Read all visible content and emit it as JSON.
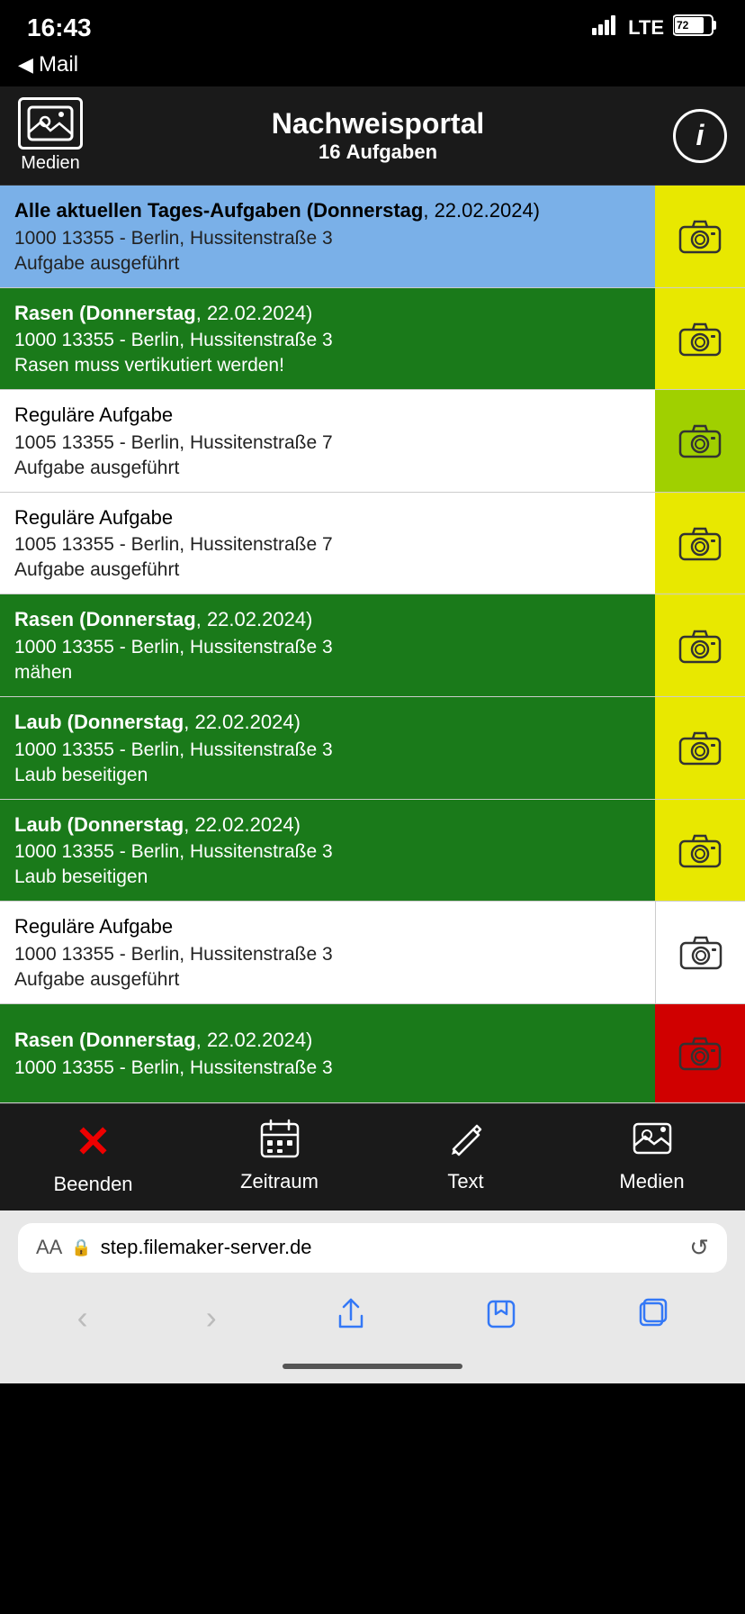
{
  "statusBar": {
    "time": "16:43",
    "signal": "▲▲▲",
    "network": "LTE",
    "battery": "72"
  },
  "mailBack": "Mail",
  "header": {
    "mediaLabel": "Medien",
    "title": "Nachweisportal",
    "subtitleCount": "16",
    "subtitleText": "Aufgaben",
    "infoLabel": "i"
  },
  "tasks": [
    {
      "id": 1,
      "bgClass": "bg-blue",
      "camClass": "cam-yellow",
      "titleBold": "Alle aktuellen Tages-Aufgaben (Donnerstag",
      "titleRest": ", 22.02.2024)",
      "address": "1000    13355 - Berlin, Hussitenstraße 3",
      "desc": "Aufgabe ausgeführt"
    },
    {
      "id": 2,
      "bgClass": "bg-green",
      "camClass": "cam-yellow",
      "titleBold": "Rasen (Donnerstag",
      "titleRest": ", 22.02.2024)",
      "address": "1000    13355 - Berlin, Hussitenstraße 3",
      "desc": "Rasen muss vertikutiert werden!"
    },
    {
      "id": 3,
      "bgClass": "bg-white",
      "camClass": "cam-lime",
      "titleBold": "",
      "titleRest": "Reguläre Aufgabe",
      "address": "1005    13355 - Berlin, Hussitenstraße 7",
      "desc": "Aufgabe ausgeführt"
    },
    {
      "id": 4,
      "bgClass": "bg-white",
      "camClass": "cam-yellow",
      "titleBold": "",
      "titleRest": "Reguläre Aufgabe",
      "address": "1005    13355 - Berlin, Hussitenstraße 7",
      "desc": "Aufgabe ausgeführt"
    },
    {
      "id": 5,
      "bgClass": "bg-green",
      "camClass": "cam-yellow",
      "titleBold": "Rasen (Donnerstag",
      "titleRest": ", 22.02.2024)",
      "address": "1000    13355 - Berlin, Hussitenstraße 3",
      "desc": "mähen"
    },
    {
      "id": 6,
      "bgClass": "bg-green",
      "camClass": "cam-yellow",
      "titleBold": "Laub (Donnerstag",
      "titleRest": ", 22.02.2024)",
      "address": "1000    13355 - Berlin, Hussitenstraße 3",
      "desc": "Laub beseitigen"
    },
    {
      "id": 7,
      "bgClass": "bg-green",
      "camClass": "cam-yellow",
      "titleBold": "Laub (Donnerstag",
      "titleRest": ", 22.02.2024)",
      "address": "1000    13355 - Berlin, Hussitenstraße 3",
      "desc": "Laub beseitigen"
    },
    {
      "id": 8,
      "bgClass": "bg-white",
      "camClass": "cam-white",
      "titleBold": "",
      "titleRest": "Reguläre Aufgabe",
      "address": "1000    13355 - Berlin, Hussitenstraße 3",
      "desc": "Aufgabe ausgeführt"
    },
    {
      "id": 9,
      "bgClass": "bg-green",
      "camClass": "cam-red",
      "titleBold": "Rasen (Donnerstag",
      "titleRest": ", 22.02.2024)",
      "address": "1000   13355 - Berlin, Hussitenstraße 3",
      "desc": ""
    }
  ],
  "tabBar": {
    "items": [
      {
        "id": "beenden",
        "label": "Beenden",
        "iconType": "x"
      },
      {
        "id": "zeitraum",
        "label": "Zeitraum",
        "iconType": "calendar"
      },
      {
        "id": "text",
        "label": "Text",
        "iconType": "pencil"
      },
      {
        "id": "medien",
        "label": "Medien",
        "iconType": "media"
      }
    ]
  },
  "browser": {
    "aaLabel": "AA",
    "url": "step.filemaker-server.de"
  }
}
